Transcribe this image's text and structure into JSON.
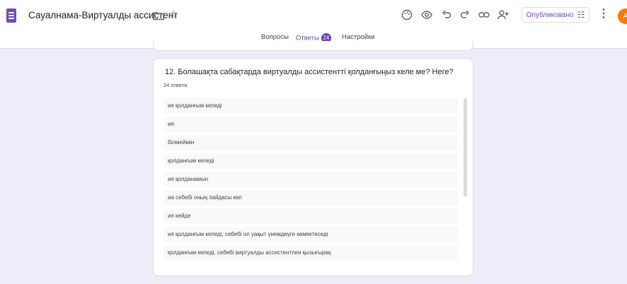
{
  "header": {
    "title": "Сауалнама-Виртуалды ассистент",
    "publish_label": "Опубликовано",
    "avatar_letter": "A",
    "icons": [
      "folder-icon",
      "star-icon",
      "palette-icon",
      "eye-icon",
      "undo-icon",
      "redo-icon",
      "link-icon",
      "add-collaborator-icon",
      "tune-icon",
      "more-vert-icon"
    ]
  },
  "tabs": {
    "questions": "Вопросы",
    "responses": "Ответы",
    "responses_count": "24",
    "settings": "Настройки"
  },
  "question": {
    "title": "12.  Болашақта сабақтарда виртуалды ассистентті қолданғыңыз келе ме? Неге?",
    "count": "24 ответа",
    "responses": [
      "ия қолданғым келеді",
      "ия",
      "білмеймін",
      "қолданғым келеді",
      "ия қолданамын",
      "иа себебі оның пайдасы көп",
      "ия кейде",
      "ия қолданғым келеді, себебі ол уақыт үнемдеуге көмектеседі",
      "қолданғым келеді, себебі виртуалды ассистентпен қызығырақ"
    ]
  },
  "colors": {
    "accent": "#673ab7",
    "background": "#f0ebf8",
    "avatar": "#f57c00"
  }
}
